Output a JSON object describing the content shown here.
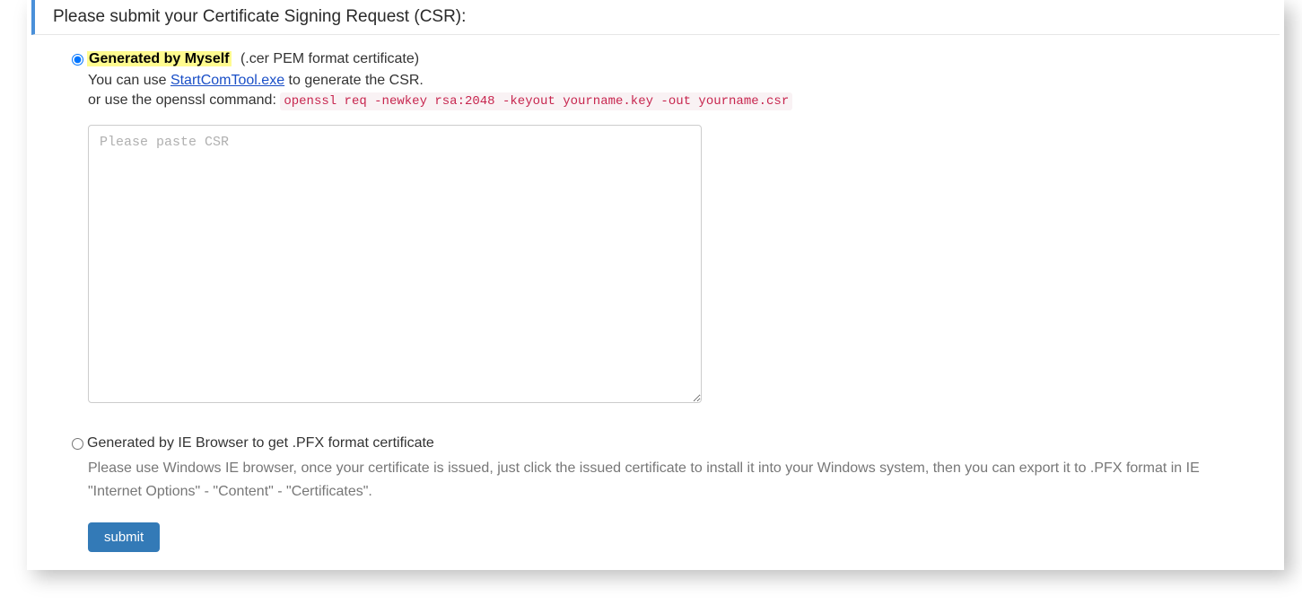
{
  "header": {
    "title": "Please submit your Certificate Signing Request (CSR):"
  },
  "option1": {
    "label": "Generated by Myself",
    "suffix": "(.cer PEM format certificate)",
    "desc_prefix": "You can use ",
    "tool_link": "StartComTool.exe",
    "desc_suffix": " to generate the CSR.",
    "cmd_prefix": "or use the openssl command: ",
    "cmd_code": "openssl req -newkey rsa:2048 -keyout yourname.key -out yourname.csr",
    "textarea_placeholder": "Please paste CSR"
  },
  "option2": {
    "label": "Generated by IE Browser to get .PFX format certificate",
    "desc": "Please use Windows IE browser, once your certificate is issued, just click the issued certificate to install it into your Windows system, then you can export it to .PFX format in IE \"Internet Options\" - \"Content\" - \"Certificates\"."
  },
  "submit_label": "submit"
}
